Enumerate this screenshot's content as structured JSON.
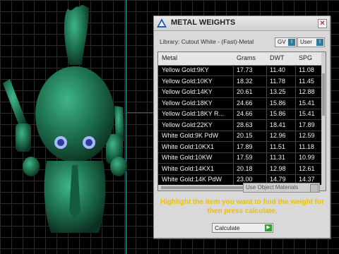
{
  "dialog": {
    "title": "METAL WEIGHTS",
    "close_glyph": "✕",
    "library_label": "Library: Cutout White - (Fast)-Metal",
    "toggles": [
      {
        "label": "GV",
        "state": "I"
      },
      {
        "label": "User",
        "state": "I"
      }
    ],
    "table": {
      "columns": [
        "Metal",
        "Grams",
        "DWT",
        "SPG"
      ],
      "rows": [
        [
          "Yellow Gold:9KY",
          "17.73",
          "11.40",
          "11.08"
        ],
        [
          "Yellow Gold:10KY",
          "18.32",
          "11.78",
          "11.45"
        ],
        [
          "Yellow Gold:14KY",
          "20.61",
          "13.25",
          "12.88"
        ],
        [
          "Yellow Gold:18KY",
          "24.66",
          "15.86",
          "15.41"
        ],
        [
          "Yellow Gold:18KY R...",
          "24.66",
          "15.86",
          "15.41"
        ],
        [
          "Yellow Gold:22KY",
          "28.63",
          "18.41",
          "17.89"
        ],
        [
          "White Gold:9K PdW",
          "20.15",
          "12.96",
          "12.59"
        ],
        [
          "White Gold:10KX1",
          "17.89",
          "11.51",
          "11.18"
        ],
        [
          "White Gold:10KW",
          "17.59",
          "11.31",
          "10.99"
        ],
        [
          "White Gold:14KX1",
          "20.18",
          "12.98",
          "12.61"
        ],
        [
          "White Gold:14K PdW",
          "23.00",
          "14.79",
          "14.37"
        ]
      ]
    },
    "use_object_materials_label": "Use Object Materials",
    "instructions": "Highlight the item you want to find the weight for then press calculate.",
    "calculate_label": "Calculate",
    "colors": {
      "accent_text": "#f0c000",
      "table_bg": "#000000",
      "figure_green": "#1d6f4c"
    }
  },
  "viewport": {
    "object": "green-figurine-model"
  }
}
